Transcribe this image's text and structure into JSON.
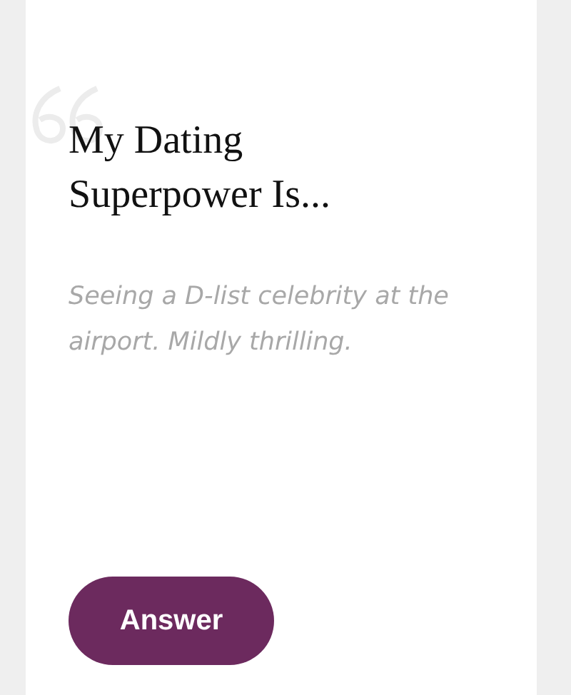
{
  "card": {
    "title": "My Dating Superpower Is...",
    "answer": "Seeing a D-list celebrity at the airport. Mildly thrilling.",
    "button": "Answer"
  }
}
